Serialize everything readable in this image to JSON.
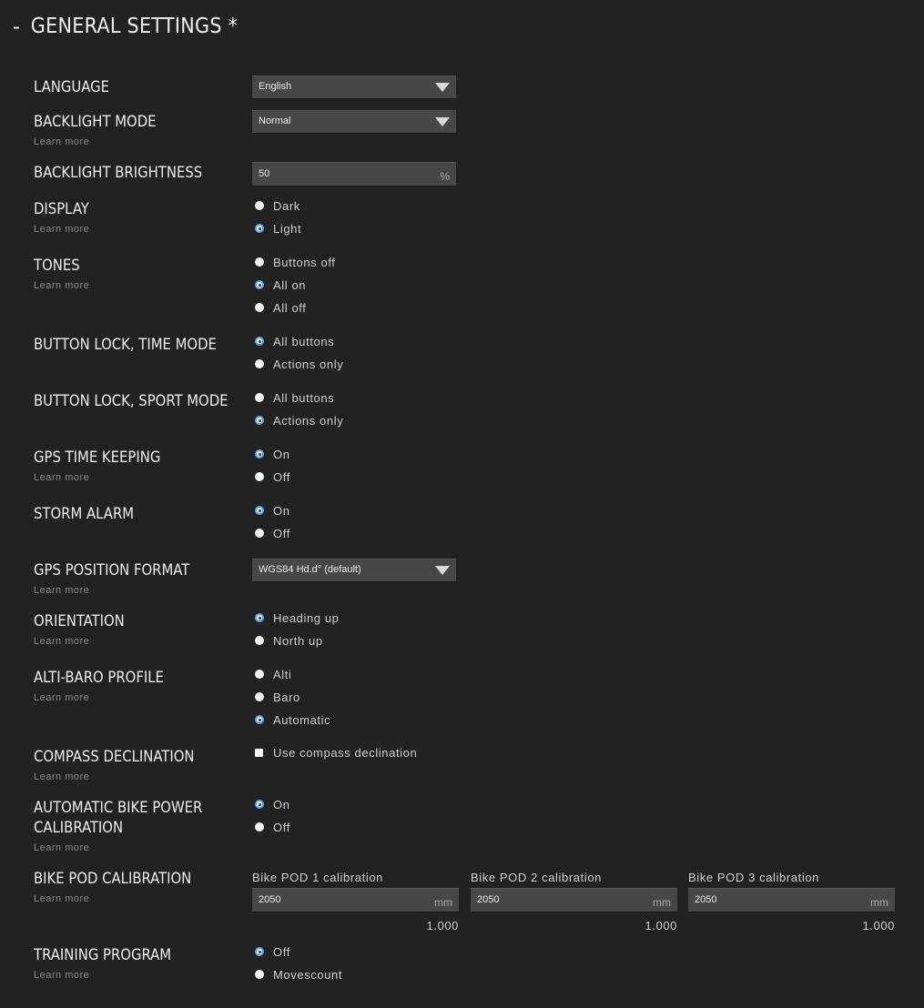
{
  "header": {
    "collapse": "-",
    "title": "GENERAL SETTINGS *"
  },
  "learn_more": "Learn more",
  "settings": {
    "language": {
      "label": "LANGUAGE",
      "value": "English"
    },
    "backlight_mode": {
      "label": "BACKLIGHT MODE",
      "value": "Normal"
    },
    "backlight_brightness": {
      "label": "BACKLIGHT BRIGHTNESS",
      "value": "50",
      "unit": "%"
    },
    "display": {
      "label": "DISPLAY",
      "options": [
        "Dark",
        "Light"
      ],
      "selected": "Light"
    },
    "tones": {
      "label": "TONES",
      "options": [
        "Buttons off",
        "All on",
        "All off"
      ],
      "selected": "All on"
    },
    "button_lock_time": {
      "label": "BUTTON LOCK, TIME MODE",
      "options": [
        "All buttons",
        "Actions only"
      ],
      "selected": "All buttons"
    },
    "button_lock_sport": {
      "label": "BUTTON LOCK, SPORT MODE",
      "options": [
        "All buttons",
        "Actions only"
      ],
      "selected": "Actions only"
    },
    "gps_time_keeping": {
      "label": "GPS TIME KEEPING",
      "options": [
        "On",
        "Off"
      ],
      "selected": "On"
    },
    "storm_alarm": {
      "label": "STORM ALARM",
      "options": [
        "On",
        "Off"
      ],
      "selected": "On"
    },
    "gps_position_format": {
      "label": "GPS POSITION FORMAT",
      "value": "WGS84 Hd.d° (default)"
    },
    "orientation": {
      "label": "ORIENTATION",
      "options": [
        "Heading up",
        "North up"
      ],
      "selected": "Heading up"
    },
    "alti_baro": {
      "label": "ALTI-BARO PROFILE",
      "options": [
        "Alti",
        "Baro",
        "Automatic"
      ],
      "selected": "Automatic"
    },
    "compass_declination": {
      "label": "COMPASS DECLINATION",
      "checkbox_label": "Use compass declination",
      "checked": false
    },
    "auto_bike_power": {
      "label_line1": "AUTOMATIC BIKE POWER",
      "label_line2": "CALIBRATION",
      "options": [
        "On",
        "Off"
      ],
      "selected": "On"
    },
    "bike_pod": {
      "label": "BIKE POD CALIBRATION",
      "pods": [
        {
          "title": "Bike POD 1 calibration",
          "value": "2050",
          "unit": "mm",
          "factor": "1.000"
        },
        {
          "title": "Bike POD 2 calibration",
          "value": "2050",
          "unit": "mm",
          "factor": "1.000"
        },
        {
          "title": "Bike POD 3 calibration",
          "value": "2050",
          "unit": "mm",
          "factor": "1.000"
        }
      ]
    },
    "training_program": {
      "label": "TRAINING PROGRAM",
      "options": [
        "Off",
        "Movescount"
      ],
      "selected": "Off"
    }
  }
}
